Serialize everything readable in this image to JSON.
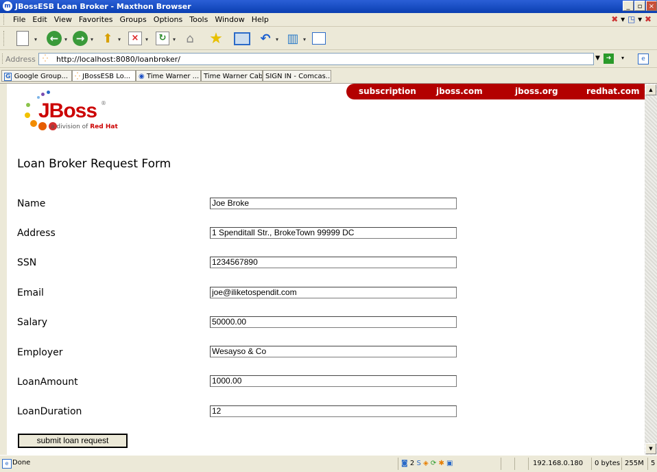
{
  "window": {
    "title": "JBossESB Loan Broker - Maxthon Browser",
    "app_icon_letter": "m",
    "min_glyph": "_",
    "restore_glyph": "▫",
    "close_glyph": "×"
  },
  "menu": [
    "File",
    "Edit",
    "View",
    "Favorites",
    "Groups",
    "Options",
    "Tools",
    "Window",
    "Help"
  ],
  "address": {
    "label": "Address",
    "url": "http://localhost:8080/loanbroker/"
  },
  "tabs": [
    {
      "label": "Google Group..."
    },
    {
      "label": "JBossESB Lo..."
    },
    {
      "label": "Time Warner ..."
    },
    {
      "label": "Time Warner Cabl..."
    },
    {
      "label": "SIGN IN - Comcas..."
    }
  ],
  "page": {
    "nav_links": [
      "subscription",
      "jboss.com",
      "jboss.org",
      "redhat.com"
    ],
    "logo": {
      "word": "JBoss",
      "sub_prefix": "a division of",
      "sub_brand": "Red Hat",
      "reg": "®"
    },
    "form_title": "Loan Broker Request Form",
    "fields": [
      {
        "label": "Name",
        "value": "Joe Broke"
      },
      {
        "label": "Address",
        "value": "1 Spenditall Str., BrokeTown 99999 DC"
      },
      {
        "label": "SSN",
        "value": "1234567890"
      },
      {
        "label": "Email",
        "value": "joe@iliketospendit.com"
      },
      {
        "label": "Salary",
        "value": "50000.00"
      },
      {
        "label": "Employer",
        "value": "Wesayso & Co"
      },
      {
        "label": "LoanAmount",
        "value": "1000.00"
      },
      {
        "label": "LoanDuration",
        "value": "12"
      }
    ],
    "submit_label": "submit loan request"
  },
  "status": {
    "text": "Done",
    "count": "2",
    "ip": "192.168.0.180",
    "bytes": "0 bytes",
    "memory": "255M",
    "trailing": "5"
  },
  "colors": {
    "nav_red": "#b30000",
    "title_blue": "#1b4fc4",
    "chrome": "#ece9d8"
  }
}
